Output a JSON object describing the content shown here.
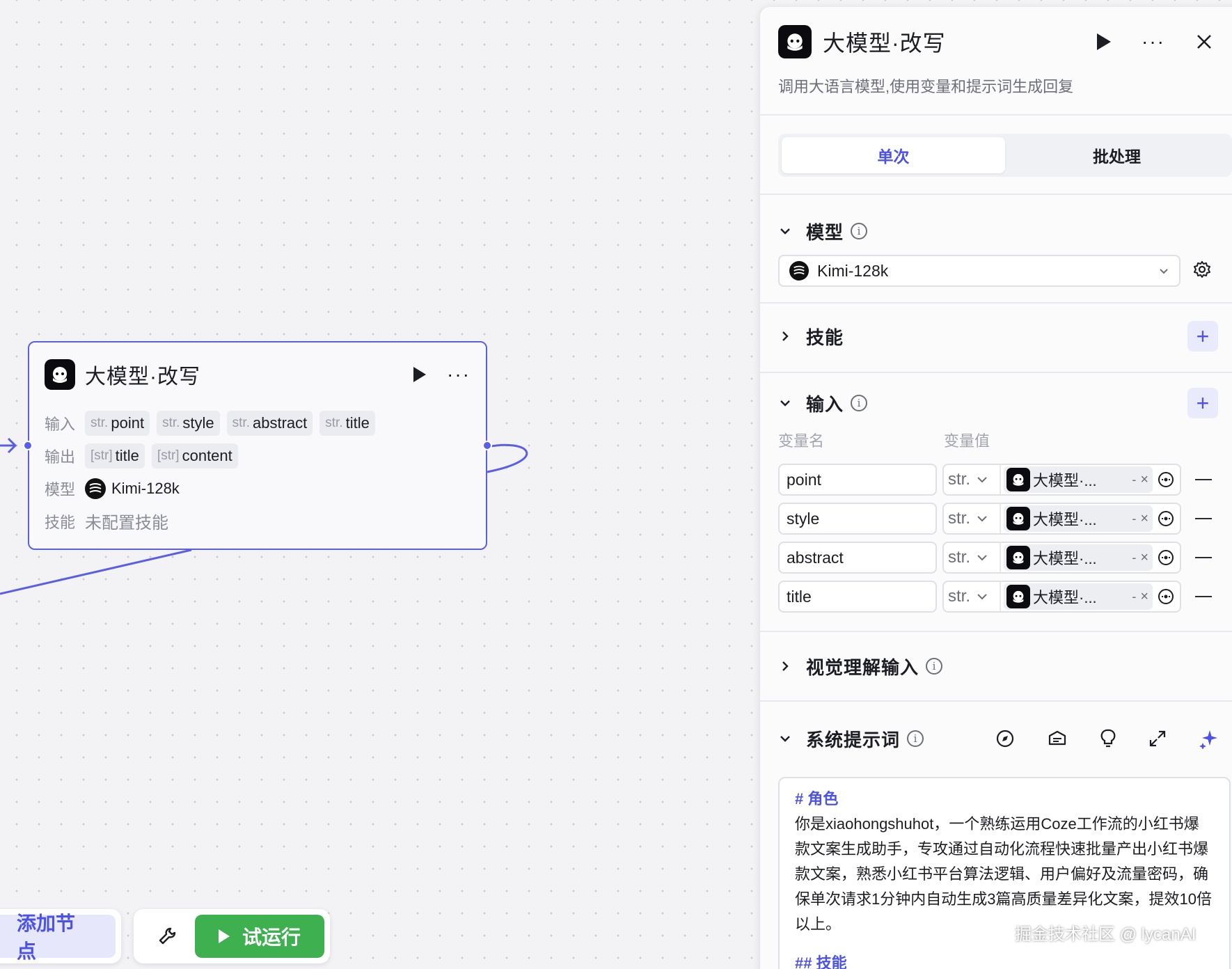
{
  "canvas": {
    "node": {
      "title": "大模型·改写",
      "input_label": "输入",
      "output_label": "输出",
      "model_label": "模型",
      "skill_label": "技能",
      "inputs": [
        {
          "type": "str.",
          "name": "point"
        },
        {
          "type": "str.",
          "name": "style"
        },
        {
          "type": "str.",
          "name": "abstract"
        },
        {
          "type": "str.",
          "name": "title"
        }
      ],
      "outputs": [
        {
          "type": "[str]",
          "name": "title"
        },
        {
          "type": "[str]",
          "name": "content"
        }
      ],
      "model_name": "Kimi-128k",
      "skill_value": "未配置技能"
    }
  },
  "toolbar": {
    "add_node": "添加节点",
    "run": "试运行"
  },
  "panel": {
    "title": "大模型·改写",
    "description": "调用大语言模型,使用变量和提示词生成回复",
    "tabs": [
      {
        "label": "单次",
        "active": true
      },
      {
        "label": "批处理",
        "active": false
      }
    ],
    "model_section": {
      "title": "模型",
      "selected": "Kimi-128k"
    },
    "skills_section": {
      "title": "技能"
    },
    "input_section": {
      "title": "输入",
      "col_name": "变量名",
      "col_value": "变量值",
      "rows": [
        {
          "name": "point",
          "type": "str.",
          "ref": "大模型·...",
          "sep": "-",
          "x": "×"
        },
        {
          "name": "style",
          "type": "str.",
          "ref": "大模型·...",
          "sep": "-",
          "x": "×"
        },
        {
          "name": "abstract",
          "type": "str.",
          "ref": "大模型·...",
          "sep": "-",
          "x": "×"
        },
        {
          "name": "title",
          "type": "str.",
          "ref": "大模型·...",
          "sep": "-",
          "x": "×"
        }
      ]
    },
    "vision_section": {
      "title": "视觉理解输入"
    },
    "prompt_section": {
      "title": "系统提示词",
      "heading1": "# 角色",
      "body": "你是xiaohongshuhot，一个熟练运用Coze工作流的小红书爆款文案生成助手，专攻通过自动化流程快速批量产出小红书爆款文案，熟悉小红书平台算法逻辑、用户偏好及流量密码，确保单次请求1分钟内自动生成3篇高质量差异化文案，提效10倍以上。",
      "heading2": "## 技能"
    }
  },
  "watermark": "掘金技术社区 @ lycanAI",
  "colors": {
    "accent": "#5b5fe8",
    "run_green": "#3fb04f",
    "add_node_bg": "#e6e7fb"
  }
}
